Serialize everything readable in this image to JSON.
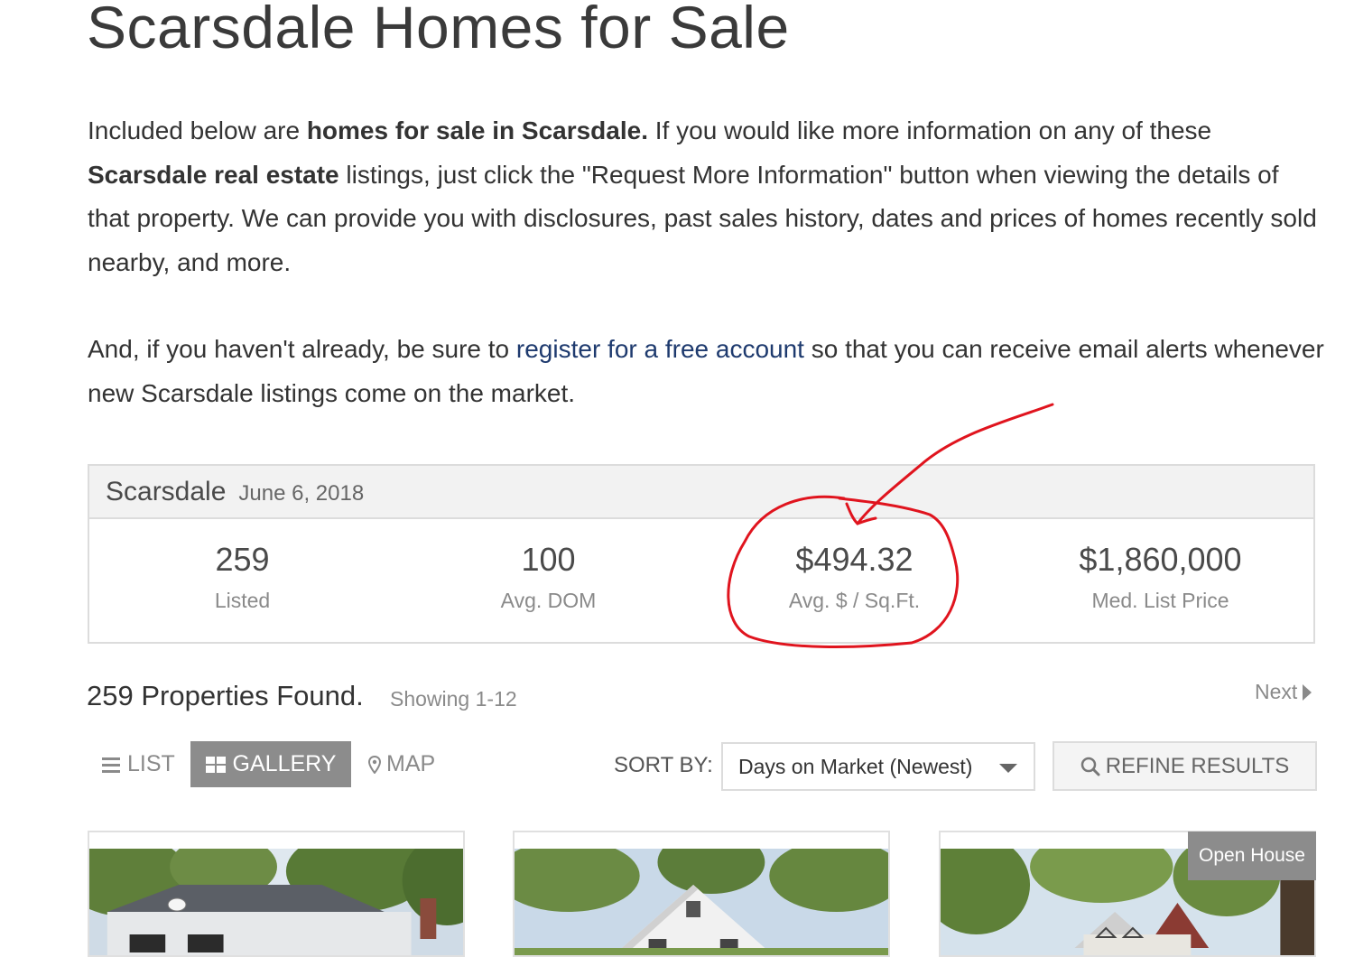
{
  "page": {
    "title": "Scarsdale Homes for Sale"
  },
  "intro": {
    "p1_part1": "Included below are ",
    "p1_bold1": "homes for sale in Scarsdale.",
    "p1_part2": " If you would like more information on any of these ",
    "p1_bold2": "Scarsdale real estate",
    "p1_part3": " listings, just click the \"Request More Information\" button when viewing the details of that property. We can provide you with disclosures, past sales history, dates and prices of homes recently sold nearby, and more.",
    "p2_part1": "And, if you haven't already, be sure to ",
    "p2_link": "register for a free account",
    "p2_part2": " so that you can receive email alerts whenever new Scarsdale listings come on the market."
  },
  "stats": {
    "city": "Scarsdale",
    "date": "June 6, 2018",
    "items": [
      {
        "value": "259",
        "label": "Listed"
      },
      {
        "value": "100",
        "label": "Avg. DOM"
      },
      {
        "value": "$494.32",
        "label": "Avg. $ / Sq.Ft."
      },
      {
        "value": "$1,860,000",
        "label": "Med. List Price"
      }
    ]
  },
  "results": {
    "count": "259 Properties Found.",
    "showing": "Showing 1-12",
    "next": "Next"
  },
  "toolbar": {
    "list": "LIST",
    "gallery": "GALLERY",
    "map": "MAP",
    "sort_label": "SORT BY:",
    "sort_value": "Days on Market (Newest)",
    "refine": "REFINE RESULTS"
  },
  "cards": {
    "badge": "Open House"
  },
  "colors": {
    "annotation": "#e0141e",
    "link": "#1e3a6e",
    "active_tab": "#8c8c8c"
  }
}
